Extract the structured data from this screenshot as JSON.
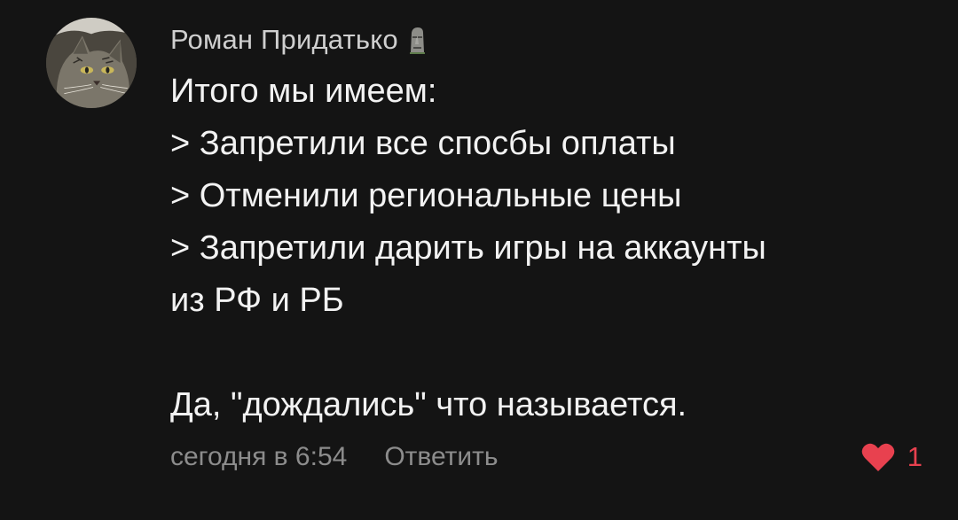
{
  "comment": {
    "author": "Роман Придатько",
    "author_emoji_icon": "moai-icon",
    "lines": [
      "Итого мы имеем:",
      "> Запретили все спосбы оплаты",
      "> Отменили региональные цены",
      "> Запретили дарить игры на аккаунты",
      "из РФ и РБ"
    ],
    "closing": "Да, \"дождались\" что называется.",
    "timestamp": "сегодня в 6:54",
    "reply_label": "Ответить",
    "like_count": "1"
  },
  "colors": {
    "background": "#141414",
    "text": "#f2f2f2",
    "author": "#cfcfcf",
    "meta": "#8c8c8c",
    "like": "#e8414f"
  }
}
